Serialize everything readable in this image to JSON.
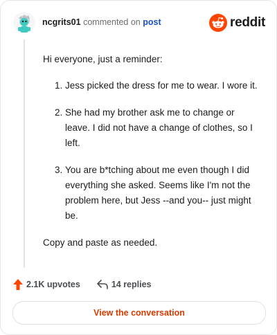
{
  "header": {
    "username": "ncgrits01",
    "verb": "commented on",
    "link_text": "post",
    "brand": "reddit"
  },
  "comment": {
    "intro": "Hi everyone, just a reminder:",
    "items": [
      "Jess picked the dress for me to wear. I wore it.",
      "She had my brother ask me to change or leave. I did not have a change of clothes, so I left.",
      "You are b*tching about me even though I did everything she asked. Seems like I'm not the problem here, but Jess --and you-- just might be."
    ],
    "outro": "Copy and paste as needed."
  },
  "actions": {
    "upvotes": "2.1K upvotes",
    "replies": "14 replies"
  },
  "cta": {
    "label": "View the conversation"
  },
  "colors": {
    "brand_orange": "#ff4500",
    "link_blue": "#1a4fc4",
    "cta_text": "#d93a00",
    "avatar_teal": "#3ec9c1"
  },
  "icons": [
    "avatar-icon",
    "reddit-logo-icon",
    "upvote-icon",
    "reply-icon"
  ]
}
